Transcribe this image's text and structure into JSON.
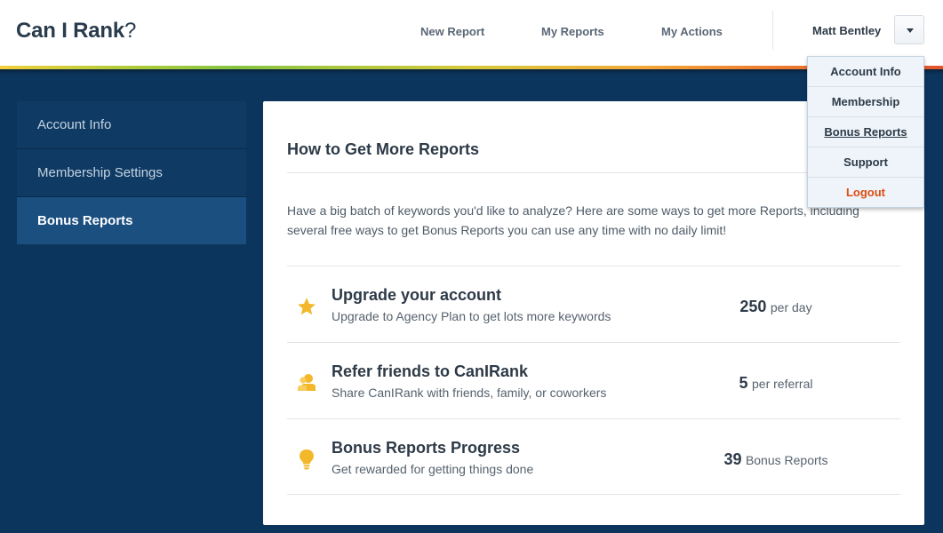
{
  "header": {
    "logo_main": "Can I Rank",
    "logo_q": "?",
    "nav": [
      "New Report",
      "My Reports",
      "My Actions"
    ],
    "user_name": "Matt Bentley",
    "dropdown_icon": "caret-down-icon"
  },
  "dropdown": {
    "items": [
      "Account Info",
      "Membership",
      "Bonus Reports",
      "Support",
      "Logout"
    ],
    "active": "Bonus Reports",
    "logout_color": "#de4d12"
  },
  "sidebar": {
    "items": [
      "Account Info",
      "Membership Settings",
      "Bonus Reports"
    ],
    "active": "Bonus Reports"
  },
  "main": {
    "title": "How to Get More Reports",
    "intro": "Have a big batch of keywords you'd like to analyze? Here are some ways to get more Reports, including several free ways to get Bonus Reports you can use any time with no daily limit!",
    "rows": [
      {
        "icon": "star-icon",
        "title": "Upgrade your account",
        "desc": "Upgrade to Agency Plan to get lots more keywords",
        "stat_value": "250",
        "stat_unit": "per day"
      },
      {
        "icon": "users-icon",
        "title": "Refer friends to CanIRank",
        "desc": "Share CanIRank with friends, family, or coworkers",
        "stat_value": "5",
        "stat_unit": "per referral"
      },
      {
        "icon": "lightbulb-icon",
        "title": "Bonus Reports Progress",
        "desc": "Get rewarded for getting things done",
        "stat_value": "39",
        "stat_unit": "Bonus Reports"
      }
    ]
  },
  "colors": {
    "background": "#0c355d",
    "accent_icon": "#f3b72a",
    "sidebar_active": "#1b4f80"
  }
}
